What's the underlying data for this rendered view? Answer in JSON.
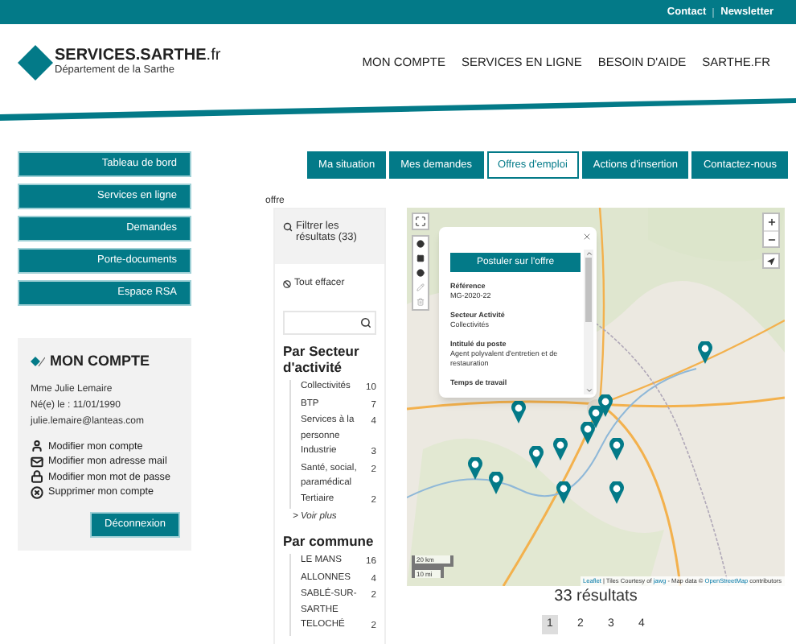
{
  "top_bar": {
    "links": [
      "Contact",
      "Newsletter"
    ]
  },
  "header": {
    "logo": {
      "title": "SERVICES.SARTHE",
      "suffix": ".fr",
      "subtitle": "Département de la Sarthe"
    },
    "nav": [
      "MON COMPTE",
      "SERVICES EN LIGNE",
      "BESOIN D'AIDE",
      "SARTHE.FR"
    ]
  },
  "sidebar": {
    "items": [
      "Tableau de bord",
      "Services en ligne",
      "Demandes",
      "Porte-documents",
      "Espace RSA"
    ]
  },
  "account": {
    "title": "MON COMPTE",
    "lines": [
      "Mme Julie Lemaire",
      "Né(e) le : 11/01/1990",
      "julie.lemaire@lanteas.com"
    ],
    "actions": [
      {
        "kind": "user",
        "label": "Modifier mon compte"
      },
      {
        "kind": "mail",
        "label": "Modifier mon adresse mail"
      },
      {
        "kind": "lock",
        "label": "Modifier mon mot de passe"
      },
      {
        "kind": "delete",
        "label": "Supprimer mon compte"
      }
    ],
    "logout": "Déconnexion"
  },
  "tabs": [
    {
      "label": "Ma situation",
      "selected": false
    },
    {
      "label": "Mes demandes",
      "selected": false
    },
    {
      "label": "Offres d'emploi",
      "selected": true
    },
    {
      "label": "Actions d'insertion",
      "selected": false
    },
    {
      "label": "Contactez-nous",
      "selected": false
    }
  ],
  "breadcrumb": "offre",
  "filters": {
    "title": "Filtrer les résultats (33)",
    "clear": "Tout effacer",
    "groups": [
      {
        "title": "Par Secteur d'activité",
        "items": [
          {
            "label": "Collectivités",
            "count": "10"
          },
          {
            "label": "BTP",
            "count": "7"
          },
          {
            "label": "Services à la personne",
            "count": "4"
          },
          {
            "label": "Industrie",
            "count": "3"
          },
          {
            "label": "Santé, social, paramédical",
            "count": "2"
          },
          {
            "label": "Tertiaire",
            "count": "2"
          }
        ],
        "more": "> Voir plus"
      },
      {
        "title": "Par commune",
        "items": [
          {
            "label": "LE MANS",
            "count": "16"
          },
          {
            "label": "ALLONNES",
            "count": "4"
          },
          {
            "label": "SABLÉ-SUR-SARTHE",
            "count": "2"
          },
          {
            "label": "TELOCHÉ",
            "count": "2"
          }
        ]
      }
    ]
  },
  "map": {
    "popup": {
      "button": "Postuler sur l'offre",
      "fields": [
        {
          "label": "Référence",
          "value": "MG-2020-22"
        },
        {
          "label": "Secteur Activité",
          "value": "Collectivités"
        },
        {
          "label": "Intitulé du poste",
          "value": "Agent polyvalent d'entretien et de restauration"
        },
        {
          "label": "Temps de travail"
        }
      ]
    },
    "scale": [
      "20 km",
      "10 mi"
    ],
    "attribution": [
      {
        "text": "Leaflet",
        "link": true
      },
      {
        "text": " | Tiles Courtesy of ",
        "link": false
      },
      {
        "text": "jawg",
        "link": true
      },
      {
        "text": " - Map data © ",
        "link": false
      },
      {
        "text": "OpenStreetMap",
        "link": true
      },
      {
        "text": " contributors",
        "link": false
      }
    ]
  },
  "results": "33 résultats",
  "pagination": [
    {
      "label": "1",
      "selected": true
    },
    {
      "label": "2",
      "selected": false
    },
    {
      "label": "3",
      "selected": false
    },
    {
      "label": "4",
      "selected": false
    }
  ]
}
